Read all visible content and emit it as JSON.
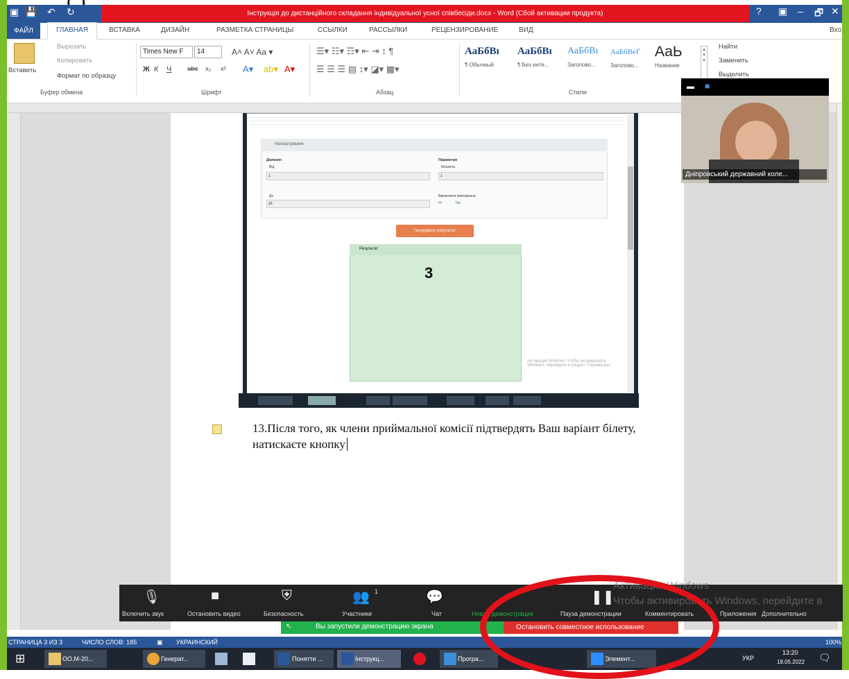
{
  "top_serif_text": "(                        )",
  "window": {
    "title": "Інструкція до дистанційного складання індивідуальної усної співбесіди.docx - Word (Сбой активации продукта)",
    "controls": [
      "?",
      "▣",
      "–",
      "🗗",
      "✕"
    ]
  },
  "ribbon_tabs": [
    "ФАЙЛ",
    "ГЛАВНАЯ",
    "ВСТАВКА",
    "ДИЗАЙН",
    "РАЗМЕТКА СТРАНИЦЫ",
    "ССЫЛКИ",
    "РАССЫЛКИ",
    "РЕЦЕНЗИРОВАНИЕ",
    "ВИД"
  ],
  "account": "Вхо",
  "clipboard": {
    "paste": "Вставить",
    "cut": "Вырезать",
    "copy": "Копировать",
    "format_painter": "Формат по образцу",
    "label": "Буфер обмена"
  },
  "font": {
    "name": "Times New F",
    "size": "14",
    "label": "Шрифт",
    "buttons": [
      "Ж",
      "К",
      "Ч",
      "abc",
      "x₂",
      "x²"
    ]
  },
  "paragraph": {
    "label": "Абзац"
  },
  "styles": {
    "label": "Стили",
    "items": [
      {
        "sample": "АаБбВı",
        "name": "¶ Обычный"
      },
      {
        "sample": "АаБбВı",
        "name": "¶ Без инте..."
      },
      {
        "sample": "АаБбВı",
        "name": "Заголово..."
      },
      {
        "sample": "АаБбВеЃ",
        "name": "Заголово..."
      },
      {
        "sample": "АаЬ",
        "name": "Название"
      }
    ]
  },
  "editing": {
    "find": "Найти",
    "replace": "Заменить",
    "select": "Выделить"
  },
  "embedded": {
    "card_title": "Налаштування",
    "range_label": "Діапазон",
    "from_label": "Від",
    "from_value": "1",
    "to_label": "До",
    "to_value": "20",
    "params_label": "Параметри",
    "count_label": "Кількість",
    "count_value": "1",
    "repeat_label": "Виключити повторення",
    "repeat_options": [
      "Ні",
      "Так"
    ],
    "generate_button": "Генерувати результат",
    "result_label": "Результат",
    "result_value": "3",
    "watermark": "Активация Windows Чтобы активировать Windows, перейдите в раздел \"Параметры\"."
  },
  "document": {
    "paragraph": "13.Після того, як члени приймальної комісії підтвердять Ваш варіант білету,",
    "paragraph_cont": "натискаєте кнопку"
  },
  "video": {
    "participant": "Дніпровський державний коле..."
  },
  "zoom_toolbar": {
    "items": [
      "Включить звук",
      "Остановить видео",
      "Безопасность",
      "Участники",
      "Чат",
      "Новая демонстрация",
      "Пауза демонстрации",
      "Комментировать",
      "Приложения",
      "Дополнительно"
    ],
    "participants_count": "1",
    "share_notice": "Вы запустили демонстрацию экрана",
    "stop_share": "Остановить совместное использование"
  },
  "windows_watermark": {
    "line1": "Активация Windows",
    "line2": "Чтобы активировать Windows, перейдите в"
  },
  "statusbar": {
    "page": "СТРАНИЦА 3 ИЗ 3",
    "words": "ЧИСЛО СЛОВ: 185",
    "language": "УКРАИНСКИЙ",
    "zoom": "100%"
  },
  "taskbar": {
    "apps": [
      "OO,M-20...",
      "Генерат...",
      "Понятти ...",
      "Інструкц...",
      "Програ...",
      "Элемент..."
    ],
    "language": "УКР",
    "time": "13:20",
    "date": "18.05.2022"
  },
  "colors": {
    "word_blue": "#2b579a",
    "frame_green": "#7bbf2a",
    "alert_red": "#e3151f",
    "annotation_red": "#e2121a",
    "share_green": "#23b14d"
  }
}
